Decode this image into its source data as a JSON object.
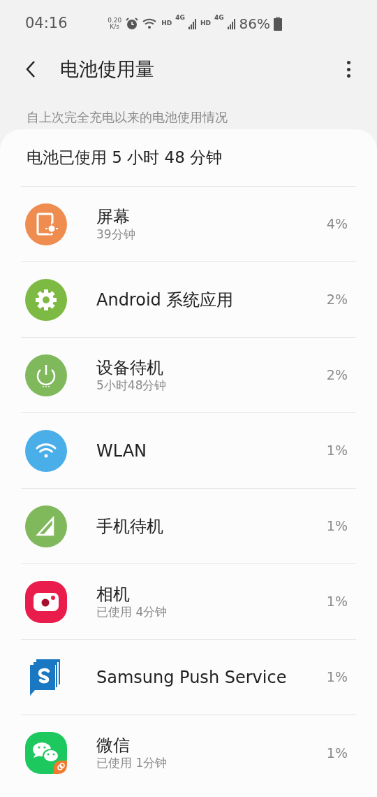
{
  "status_bar": {
    "time": "04:16",
    "speed": "0.20",
    "speed_unit": "K/s",
    "hd_1": "HD",
    "net_1": "4G",
    "hd_2": "HD",
    "net_2": "4G",
    "battery": "86%"
  },
  "header": {
    "title": "电池使用量"
  },
  "subtitle": "自上次完全充电以来的电池使用情况",
  "card": {
    "total": "电池已使用 5 小时 48 分钟",
    "items": [
      {
        "name": "屏幕",
        "detail": "39分钟",
        "percent": "4%"
      },
      {
        "name": "Android 系统应用",
        "percent": "2%"
      },
      {
        "name": "设备待机",
        "detail": "5小时48分钟",
        "percent": "2%"
      },
      {
        "name": "WLAN",
        "percent": "1%"
      },
      {
        "name": "手机待机",
        "percent": "1%"
      },
      {
        "name": "相机",
        "detail": "已使用 4分钟",
        "percent": "1%"
      },
      {
        "name": "Samsung Push Service",
        "percent": "1%"
      },
      {
        "name": "微信",
        "detail": "已使用 1分钟",
        "percent": "1%"
      }
    ]
  }
}
